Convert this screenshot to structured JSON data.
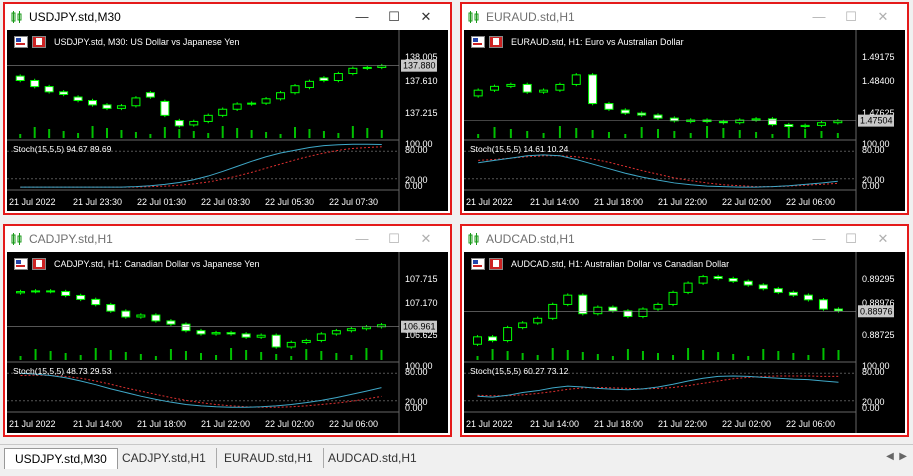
{
  "charts": [
    {
      "title": "USDJPY.std,M30",
      "header": "USDJPY.std, M30:  US Dollar vs Japanese Yen",
      "prices": [
        "138.005",
        "137.610",
        "137.215"
      ],
      "current_price": "137.880",
      "stoch_label": "Stoch(15,5,5) 94.67 89.69",
      "stoch_levels": [
        "100.00",
        "80.00",
        "20.00",
        "0.00"
      ],
      "times": [
        "21 Jul 2022",
        "21 Jul 23:30",
        "22 Jul 01:30",
        "22 Jul 03:30",
        "22 Jul 05:30",
        "22 Jul 07:30"
      ],
      "closes": [
        137.71,
        137.64,
        137.58,
        137.55,
        137.48,
        137.43,
        137.39,
        137.42,
        137.51,
        137.52,
        137.31,
        137.19,
        137.24,
        137.31,
        137.38,
        137.44,
        137.45,
        137.5,
        137.57,
        137.65,
        137.7,
        137.71,
        137.79,
        137.85,
        137.86,
        137.88
      ],
      "opens": [
        137.76,
        137.71,
        137.64,
        137.58,
        137.52,
        137.48,
        137.43,
        137.39,
        137.42,
        137.57,
        137.47,
        137.25,
        137.2,
        137.24,
        137.31,
        137.38,
        137.44,
        137.45,
        137.5,
        137.57,
        137.63,
        137.74,
        137.71,
        137.79,
        137.85,
        137.86
      ],
      "stoch_main": [
        2,
        2,
        2,
        2,
        2,
        2,
        2,
        2,
        3,
        5,
        8,
        12,
        18,
        26,
        36,
        47,
        58,
        68,
        76,
        82,
        88,
        92,
        94,
        95,
        95,
        94.67
      ],
      "stoch_signal": [
        2,
        2,
        2,
        2,
        2,
        2,
        2,
        2,
        2,
        3,
        4,
        6,
        9,
        13,
        19,
        26,
        34,
        43,
        52,
        61,
        69,
        76,
        82,
        86,
        88,
        89.69
      ],
      "price_min": 137.05,
      "price_max": 138.06,
      "selected": true
    },
    {
      "title": "EURAUD.std,H1",
      "header": "EURAUD.std, H1:  Euro vs Australian Dollar",
      "prices": [
        "1.49175",
        "1.48400",
        "1.47625"
      ],
      "current_price": "1.47504",
      "stoch_label": "Stoch(15,5,5) 14.61 10.24",
      "stoch_levels": [
        "100.00",
        "80.00",
        "20.00",
        "0.00"
      ],
      "times": [
        "21 Jul 2022",
        "21 Jul 14:00",
        "21 Jul 18:00",
        "21 Jul 22:00",
        "22 Jul 02:00",
        "22 Jul 06:00"
      ],
      "closes": [
        1.483,
        1.484,
        1.4845,
        1.4825,
        1.483,
        1.4845,
        1.487,
        1.4795,
        1.478,
        1.477,
        1.4765,
        1.4757,
        1.475,
        1.4752,
        1.4748,
        1.4745,
        1.4752,
        1.4755,
        1.474,
        1.4735,
        1.4738,
        1.4745,
        1.475
      ],
      "opens": [
        1.4815,
        1.483,
        1.484,
        1.4845,
        1.4825,
        1.483,
        1.4845,
        1.487,
        1.4795,
        1.4778,
        1.477,
        1.4765,
        1.4757,
        1.4748,
        1.4752,
        1.4748,
        1.4745,
        1.4752,
        1.4755,
        1.474,
        1.4735,
        1.4738,
        1.4745
      ],
      "stoch_main": [
        55,
        60,
        65,
        70,
        72,
        70,
        62,
        52,
        42,
        32,
        24,
        17,
        11,
        7,
        4,
        3,
        2,
        2,
        3,
        5,
        8,
        11,
        14.61
      ],
      "stoch_signal": [
        60,
        62,
        65,
        68,
        70,
        70,
        68,
        63,
        56,
        47,
        38,
        30,
        22,
        16,
        11,
        7,
        5,
        3,
        3,
        4,
        6,
        8,
        10.24
      ],
      "price_min": 1.4705,
      "price_max": 1.4935,
      "selected": false
    },
    {
      "title": "CADJPY.std,H1",
      "header": "CADJPY.std, H1:  Canadian Dollar vs Japanese Yen",
      "prices": [
        "107.715",
        "107.170",
        "106.625"
      ],
      "current_price": "106.961",
      "stoch_label": "Stoch(15,5,5) 48.73 29.53",
      "stoch_levels": [
        "100.00",
        "80.00",
        "20.00",
        "0.00"
      ],
      "times": [
        "21 Jul 2022",
        "21 Jul 14:00",
        "21 Jul 18:00",
        "21 Jul 22:00",
        "22 Jul 02:00",
        "22 Jul 06:00"
      ],
      "closes": [
        107.5,
        107.51,
        107.5,
        107.44,
        107.38,
        107.3,
        107.2,
        107.11,
        107.14,
        107.05,
        107.0,
        106.9,
        106.85,
        106.87,
        106.85,
        106.8,
        106.83,
        106.65,
        106.72,
        106.75,
        106.85,
        106.9,
        106.93,
        106.96,
        106.99
      ],
      "opens": [
        107.48,
        107.5,
        107.51,
        107.5,
        107.44,
        107.38,
        107.3,
        107.2,
        107.11,
        107.14,
        107.05,
        107.0,
        106.9,
        106.85,
        106.87,
        106.85,
        106.8,
        106.83,
        106.65,
        106.72,
        106.75,
        106.85,
        106.9,
        106.93,
        106.96
      ],
      "stoch_main": [
        80,
        78,
        75,
        70,
        63,
        55,
        46,
        38,
        30,
        23,
        17,
        12,
        9,
        7,
        6,
        6,
        7,
        9,
        12,
        16,
        21,
        27,
        34,
        41,
        48.73
      ],
      "stoch_signal": [
        75,
        76,
        75,
        73,
        69,
        63,
        56,
        48,
        41,
        34,
        27,
        21,
        16,
        12,
        9,
        7,
        6,
        6,
        7,
        9,
        12,
        15,
        19,
        24,
        29.53
      ],
      "price_min": 106.45,
      "price_max": 107.8,
      "selected": false
    },
    {
      "title": "AUDCAD.std,H1",
      "header": "AUDCAD.std, H1:  Australian Dollar vs Canadian Dollar",
      "prices": [
        "0.89295",
        "0.88976",
        "0.88725"
      ],
      "current_price": "0.88976",
      "stoch_label": "Stoch(15,5,5) 60.27 73.12",
      "stoch_levels": [
        "100.00",
        "80.00",
        "20.00",
        "0.00"
      ],
      "times": [
        "21 Jul 2022",
        "21 Jul 14:00",
        "21 Jul 18:00",
        "21 Jul 22:00",
        "22 Jul 02:00",
        "22 Jul 06:00"
      ],
      "closes": [
        0.887,
        0.8866,
        0.888,
        0.8885,
        0.889,
        0.8905,
        0.8915,
        0.8895,
        0.8902,
        0.8898,
        0.8892,
        0.89,
        0.8905,
        0.8918,
        0.8928,
        0.8935,
        0.8933,
        0.893,
        0.8926,
        0.8922,
        0.8918,
        0.8915,
        0.891,
        0.89,
        0.8898
      ],
      "opens": [
        0.8862,
        0.887,
        0.8866,
        0.888,
        0.8885,
        0.889,
        0.8905,
        0.8915,
        0.8895,
        0.8902,
        0.8898,
        0.8892,
        0.89,
        0.8905,
        0.8918,
        0.8928,
        0.8935,
        0.8933,
        0.893,
        0.8926,
        0.8922,
        0.8918,
        0.8915,
        0.891,
        0.89
      ],
      "stoch_main": [
        30,
        28,
        32,
        38,
        42,
        48,
        52,
        50,
        47,
        45,
        44,
        46,
        50,
        56,
        63,
        69,
        73,
        74,
        73,
        71,
        69,
        67,
        66,
        63,
        60.27
      ],
      "stoch_signal": [
        32,
        31,
        31,
        33,
        36,
        40,
        45,
        48,
        49,
        48,
        47,
        46,
        47,
        49,
        53,
        58,
        63,
        68,
        71,
        73,
        74,
        74,
        74,
        73,
        73.12
      ],
      "price_min": 0.8845,
      "price_max": 0.894,
      "selected": false
    }
  ],
  "tabs": [
    "USDJPY.std,M30",
    "CADJPY.std,H1",
    "EURAUD.std,H1",
    "AUDCAD.std,H1"
  ],
  "colors": {
    "bull": "#00ff00",
    "bear": "#ffffff",
    "stoch_main": "#3fa8c8",
    "stoch_signal": "#e03030",
    "frame": "#e41a1a"
  }
}
